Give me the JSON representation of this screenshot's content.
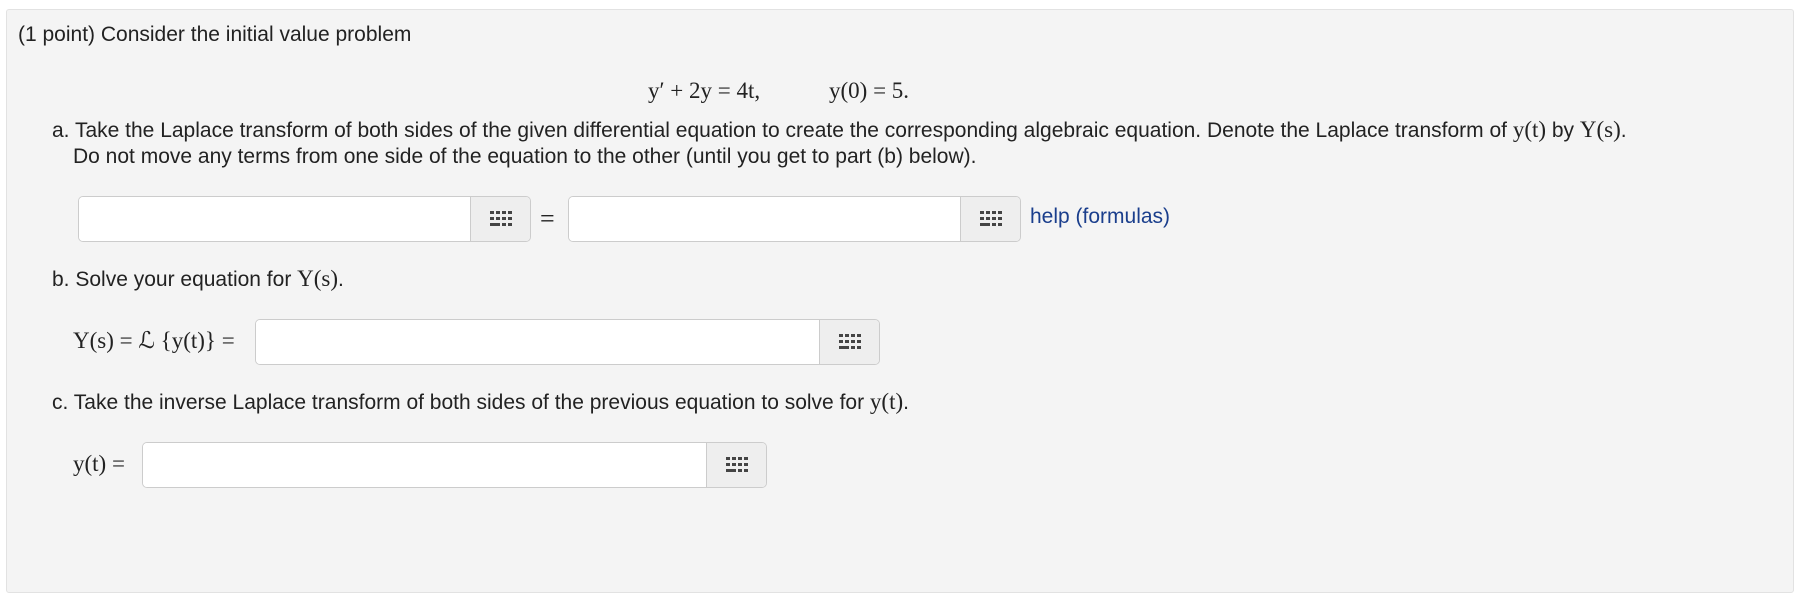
{
  "problem": {
    "header": "(1 point) Consider the initial value problem",
    "equation_lhs": "y′ + 2y = 4t,",
    "equation_ic": "y(0) = 5."
  },
  "part_a": {
    "line1_prefix": "a. Take the Laplace transform of both sides of the given differential equation to create the corresponding algebraic equation. Denote the Laplace transform of ",
    "math_yt": "y(t)",
    "by": " by ",
    "math_Ys": "Y(s)",
    "period": ".",
    "line2": "Do not move any terms from one side of the equation to the other (until you get to part (b) below).",
    "equals": "=",
    "left_input_value": "",
    "right_input_value": "",
    "help_link": "help (formulas)"
  },
  "part_b": {
    "prefix": "b. Solve your equation for ",
    "math_Ys": "Y(s)",
    "period": ".",
    "answer_label": "Y(s) = ℒ {y(t)} =",
    "input_value": ""
  },
  "part_c": {
    "prefix": "c. Take the inverse Laplace transform of both sides of the previous equation to solve for ",
    "math_yt": "y(t)",
    "period": ".",
    "answer_label": "y(t) =",
    "input_value": ""
  },
  "icons": {
    "equation_editor": "grid-icon"
  },
  "colors": {
    "panel_bg": "#f4f4f4",
    "link": "#1a3e8c",
    "button_bg": "#eeeeee"
  }
}
